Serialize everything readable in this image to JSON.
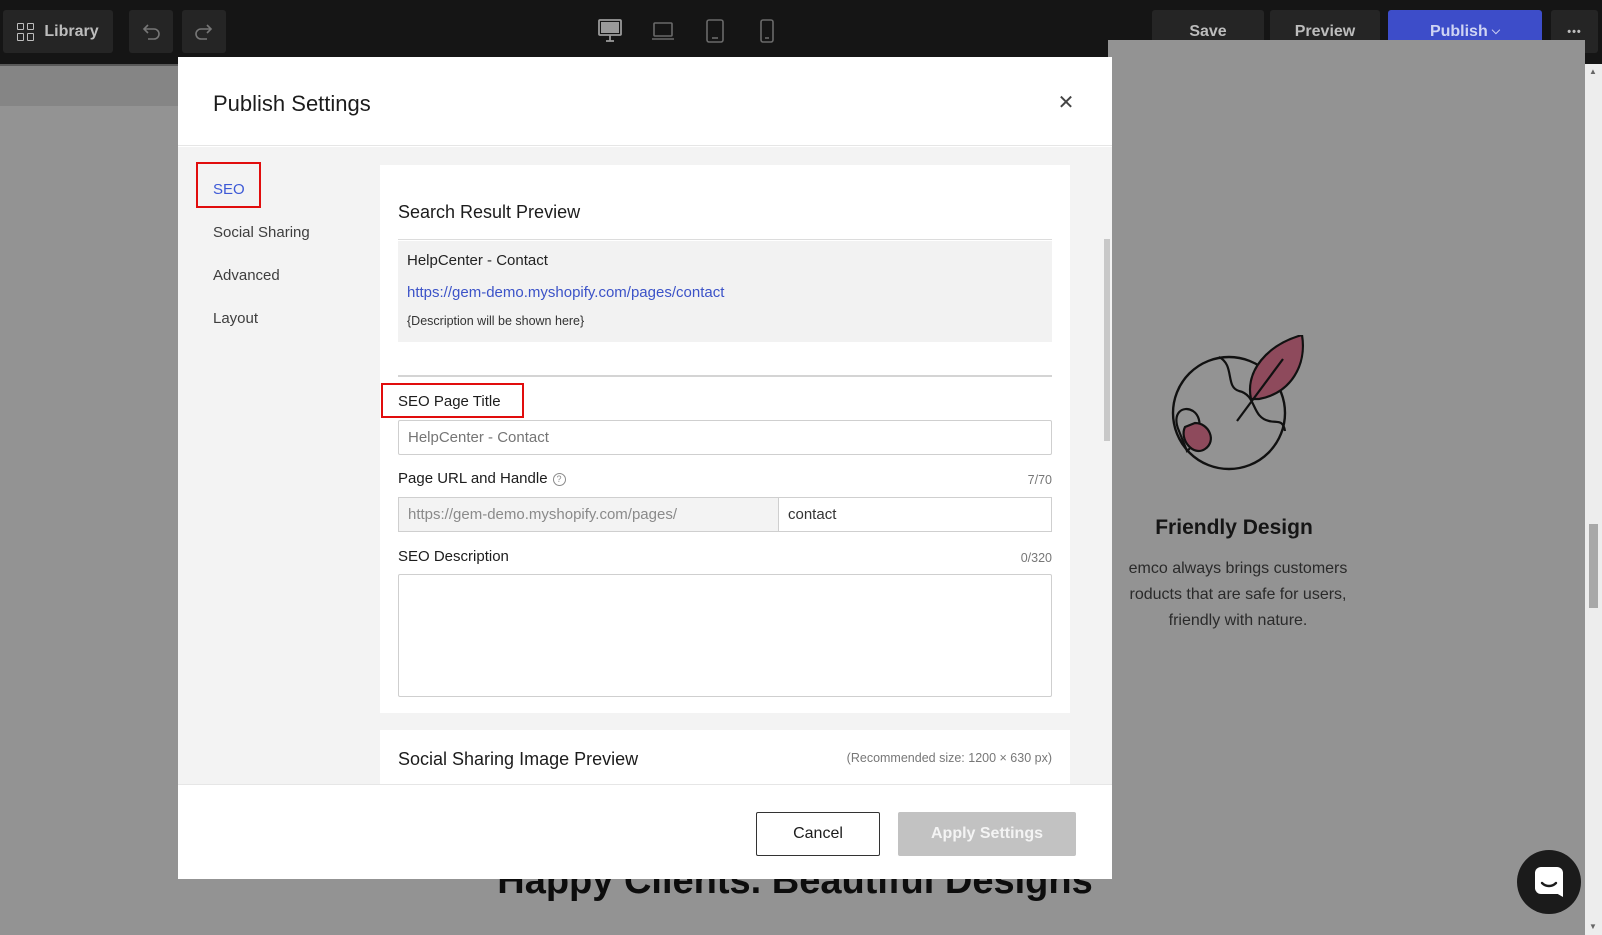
{
  "toolbar": {
    "library_label": "Library",
    "save_label": "Save",
    "preview_label": "Preview",
    "publish_label": "Publish",
    "publish_caret": "⌵",
    "more_label": "•••"
  },
  "background_page": {
    "feature_title": "Friendly Design",
    "feature_desc_line1": "emco always brings customers",
    "feature_desc_line2": "roducts that are safe for users,",
    "feature_desc_line3": "friendly with nature.",
    "section_heading": "Happy Clients. Beautiful Designs"
  },
  "modal": {
    "title": "Publish Settings",
    "close_symbol": "✕",
    "sidebar": {
      "items": [
        {
          "label": "SEO",
          "active": true
        },
        {
          "label": "Social Sharing",
          "active": false
        },
        {
          "label": "Advanced",
          "active": false
        },
        {
          "label": "Layout",
          "active": false
        }
      ]
    },
    "seo": {
      "section_title": "Search Result Preview",
      "preview": {
        "title": "HelpCenter - Contact",
        "url": "https://gem-demo.myshopify.com/pages/contact",
        "description": "{Description will be shown here}"
      },
      "page_title_label": "SEO Page Title",
      "page_title_placeholder": "HelpCenter - Contact",
      "url_label": "Page URL and Handle",
      "url_help": "?",
      "url_count": "7/70",
      "url_prefix": "https://gem-demo.myshopify.com/pages/",
      "url_handle": "contact",
      "description_label": "SEO Description",
      "description_count": "0/320",
      "description_value": ""
    },
    "social": {
      "section_title": "Social Sharing Image Preview",
      "recommended_size": "(Recommended size: 1200 × 630 px)"
    },
    "footer": {
      "cancel_label": "Cancel",
      "apply_label": "Apply Settings"
    }
  },
  "colors": {
    "accent": "#3d59d6",
    "publish_button": "#3d4dc9",
    "highlight_box": "#e10d0d",
    "leaf": "#8e4a5c"
  }
}
